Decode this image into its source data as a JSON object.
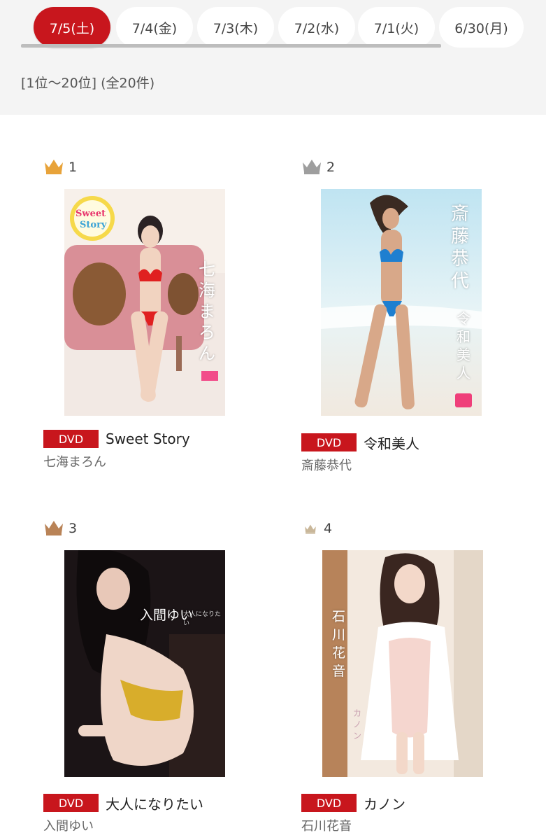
{
  "date_tabs": [
    {
      "label": "7/5(土)",
      "active": true
    },
    {
      "label": "7/4(金)",
      "active": false
    },
    {
      "label": "7/3(木)",
      "active": false
    },
    {
      "label": "7/2(水)",
      "active": false
    },
    {
      "label": "7/1(火)",
      "active": false
    },
    {
      "label": "6/30(月)",
      "active": false
    }
  ],
  "range_text": "[1位〜20位] (全20件)",
  "colors": {
    "accent": "#c8161d",
    "gold": "#e8a33a",
    "silver": "#9e9e9e",
    "bronze": "#b98357",
    "fourth": "#c9b79a"
  },
  "ranking": [
    {
      "rank": "1",
      "crown": "gold-crown-icon",
      "format": "DVD",
      "title": "Sweet Story",
      "artist": "七海まろん",
      "cover_text": [
        "Sweet",
        "Story",
        "七海まろん"
      ]
    },
    {
      "rank": "2",
      "crown": "silver-crown-icon",
      "format": "DVD",
      "title": "令和美人",
      "artist": "斎藤恭代",
      "cover_text": [
        "斎藤恭代",
        "令和美人"
      ]
    },
    {
      "rank": "3",
      "crown": "bronze-crown-icon",
      "format": "DVD",
      "title": "大人になりたい",
      "artist": "入間ゆい",
      "cover_text": [
        "入間ゆい",
        "大人になりたい"
      ]
    },
    {
      "rank": "4",
      "crown": "small-crown-icon",
      "format": "DVD",
      "title": "カノン",
      "artist": "石川花音",
      "cover_text": [
        "石川花音",
        "カノン"
      ]
    }
  ]
}
